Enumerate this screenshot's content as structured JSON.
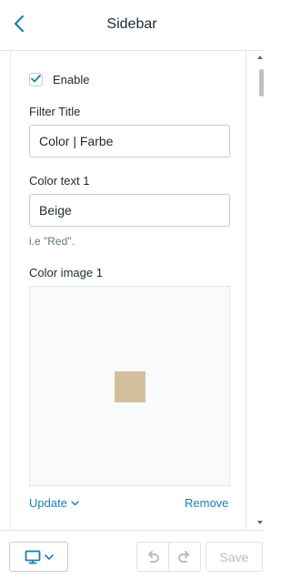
{
  "header": {
    "title": "Sidebar"
  },
  "settings": {
    "enable_label": "Enable",
    "enable_checked": true,
    "filter_title_label": "Filter Title",
    "filter_title_value": "Color | Farbe",
    "color_text_label": "Color text 1",
    "color_text_value": "Beige",
    "color_text_help": "i.e \"Red\".",
    "color_image_label": "Color image 1",
    "swatch_color": "#d4bf9c",
    "update_label": "Update",
    "remove_label": "Remove"
  },
  "footer": {
    "save_label": "Save"
  },
  "colors": {
    "accent": "#1a7fb0",
    "link": "#1a7fb0",
    "disabled": "#b6bec6"
  },
  "icons": {
    "back": "chevron-left-icon",
    "checkbox": "checkmark-icon",
    "update": "chevron-down-icon",
    "device": "desktop-icon",
    "undo": "undo-icon",
    "redo": "redo-icon"
  }
}
